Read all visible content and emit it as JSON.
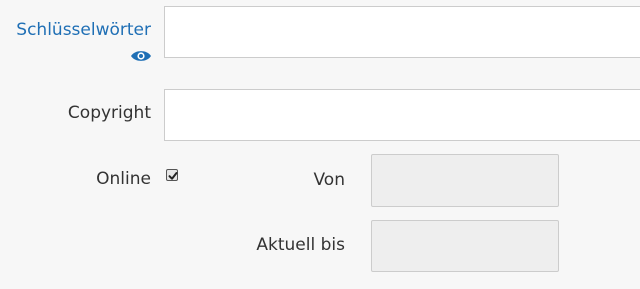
{
  "form": {
    "keywords": {
      "label": "Schlüsselwörter",
      "value": "",
      "label_color": "#1f6fb5",
      "toggle_icon": "eye-icon"
    },
    "copyright": {
      "label": "Copyright",
      "value": ""
    },
    "online": {
      "label": "Online",
      "checked": true
    },
    "from": {
      "label": "Von",
      "value": ""
    },
    "until": {
      "label": "Aktuell bis",
      "value": ""
    }
  }
}
